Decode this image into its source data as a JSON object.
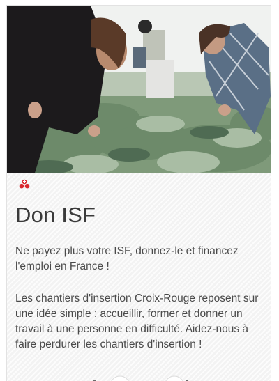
{
  "card": {
    "title": "Don ISF",
    "paragraph_1": "Ne payez plus votre ISF, donnez-le et financez l'emploi en France !",
    "paragraph_2": "Les chantiers d'insertion Croix-Rouge reposent sur une idée simple : accueillir, former et donner un travail à une personne en difficulté. Aidez-nous à faire perdurer les chantiers d'insertion !"
  },
  "colors": {
    "brand_red": "#d9282f",
    "text_dark": "#3a3a3a",
    "text_body": "#4a4a4a"
  },
  "icons": {
    "logo": "croix-rouge-logo-icon"
  }
}
